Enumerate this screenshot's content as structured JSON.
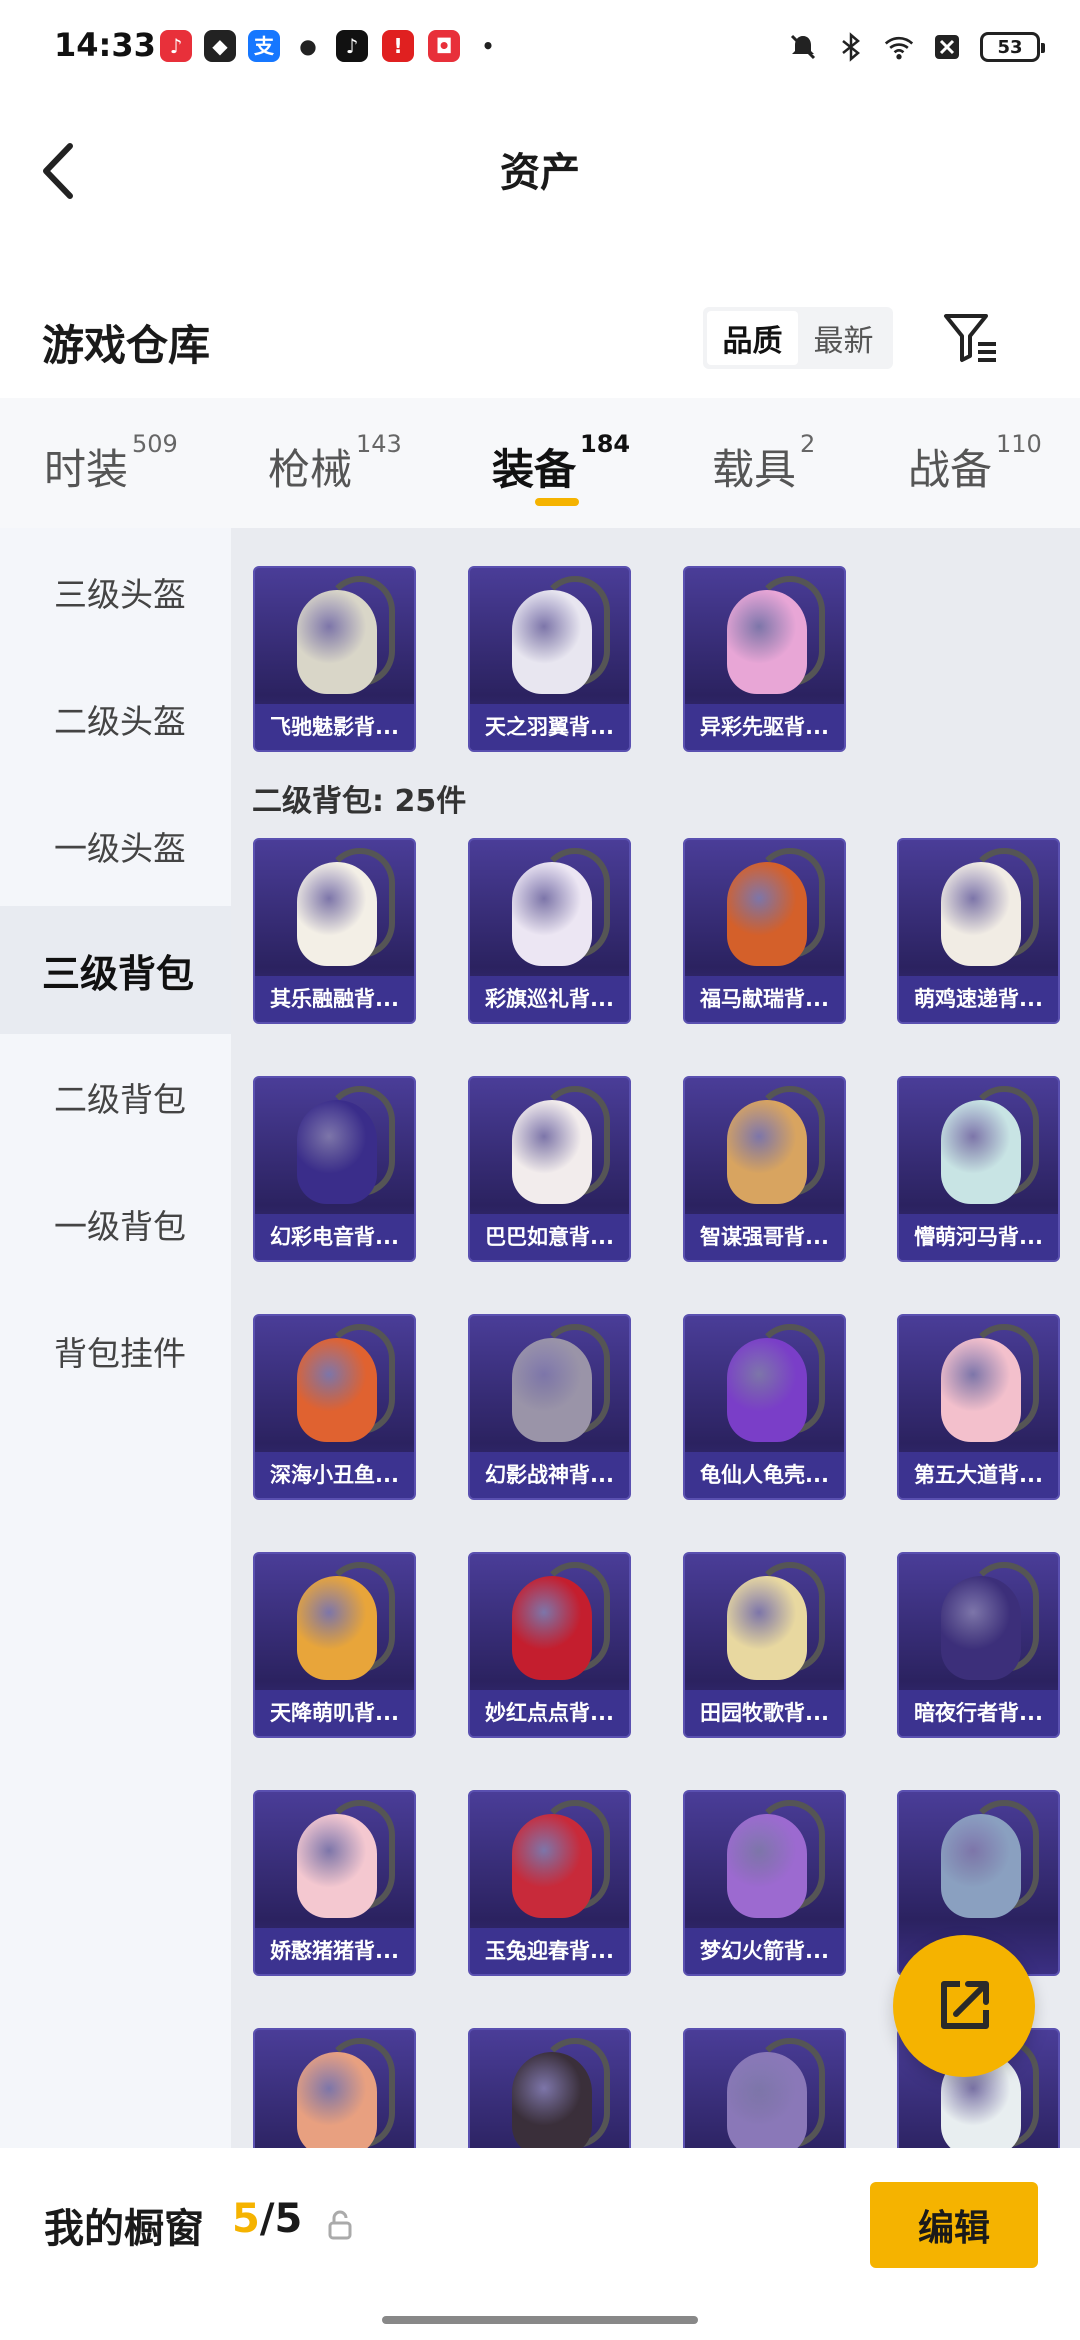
{
  "status_bar": {
    "time": "14:33",
    "battery": "53",
    "app_icons": [
      "music-app-icon",
      "security-app-icon",
      "alipay-app-icon",
      "wechat-app-icon",
      "tiktok-app-icon",
      "red-app-icon",
      "taobao-app-icon"
    ],
    "right_icons": [
      "mute-icon",
      "bluetooth-icon",
      "wifi-icon",
      "notification-icon"
    ]
  },
  "nav": {
    "title": "资产"
  },
  "warehouse": {
    "title": "游戏仓库",
    "sort_options": [
      "品质",
      "最新"
    ],
    "active_sort": "品质"
  },
  "tabs": [
    {
      "label": "时装",
      "count": "509"
    },
    {
      "label": "枪械",
      "count": "143"
    },
    {
      "label": "装备",
      "count": "184",
      "active": true
    },
    {
      "label": "载具",
      "count": "2"
    },
    {
      "label": "战备",
      "count": "110"
    }
  ],
  "sidebar": {
    "items": [
      "三级头盔",
      "二级头盔",
      "一级头盔",
      "三级背包",
      "二级背包",
      "一级背包",
      "背包挂件"
    ],
    "active": "三级背包"
  },
  "section_label": "二级背包: 25件",
  "top_row": [
    {
      "name": "飞驰魅影背...",
      "color": "#d9d6c8"
    },
    {
      "name": "天之羽翼背...",
      "color": "#e8e6f0"
    },
    {
      "name": "异彩先驱背...",
      "color": "#e8a6d6"
    }
  ],
  "grid_items": [
    {
      "name": "其乐融融背...",
      "color": "#f3efe6"
    },
    {
      "name": "彩旗巡礼背...",
      "color": "#ece6f3"
    },
    {
      "name": "福马献瑞背...",
      "color": "#d4602a"
    },
    {
      "name": "萌鸡速递背...",
      "color": "#f1ece4"
    },
    {
      "name": "幻彩电音背...",
      "color": "#3a2d8a"
    },
    {
      "name": "巴巴如意背...",
      "color": "#f2ecec"
    },
    {
      "name": "智谋强哥背...",
      "color": "#d8a460"
    },
    {
      "name": "懵萌河马背...",
      "color": "#c8e4e4"
    },
    {
      "name": "深海小丑鱼...",
      "color": "#e06230"
    },
    {
      "name": "幻影战神背...",
      "color": "#9a94a8"
    },
    {
      "name": "龟仙人龟壳...",
      "color": "#7a3ec8"
    },
    {
      "name": "第五大道背...",
      "color": "#f3c0cc"
    },
    {
      "name": "天降萌叽背...",
      "color": "#e8a53a"
    },
    {
      "name": "妙红点点背...",
      "color": "#c41e2e"
    },
    {
      "name": "田园牧歌背...",
      "color": "#e8d8a0"
    },
    {
      "name": "暗夜行者背...",
      "color": "#3c2f7a"
    },
    {
      "name": "娇憨猪猪背...",
      "color": "#f4c8d0"
    },
    {
      "name": "玉兔迎春背...",
      "color": "#c82a3a"
    },
    {
      "name": "梦幻火箭背...",
      "color": "#9c6ad0"
    },
    {
      "name": "",
      "color": "#8aa0c0"
    },
    {
      "name": "",
      "color": "#e8a080"
    },
    {
      "name": "",
      "color": "#3a2f3a"
    },
    {
      "name": "",
      "color": "#8a78b8"
    },
    {
      "name": "",
      "color": "#e8eef0"
    }
  ],
  "fab": {
    "icon": "share-external-icon"
  },
  "bottom": {
    "label": "我的橱窗",
    "count_current": "5",
    "count_total": "/5",
    "edit_label": "编辑"
  },
  "colors": {
    "accent": "#f5b300",
    "card_bg": "#2b2260",
    "card_label": "#3c3390"
  }
}
